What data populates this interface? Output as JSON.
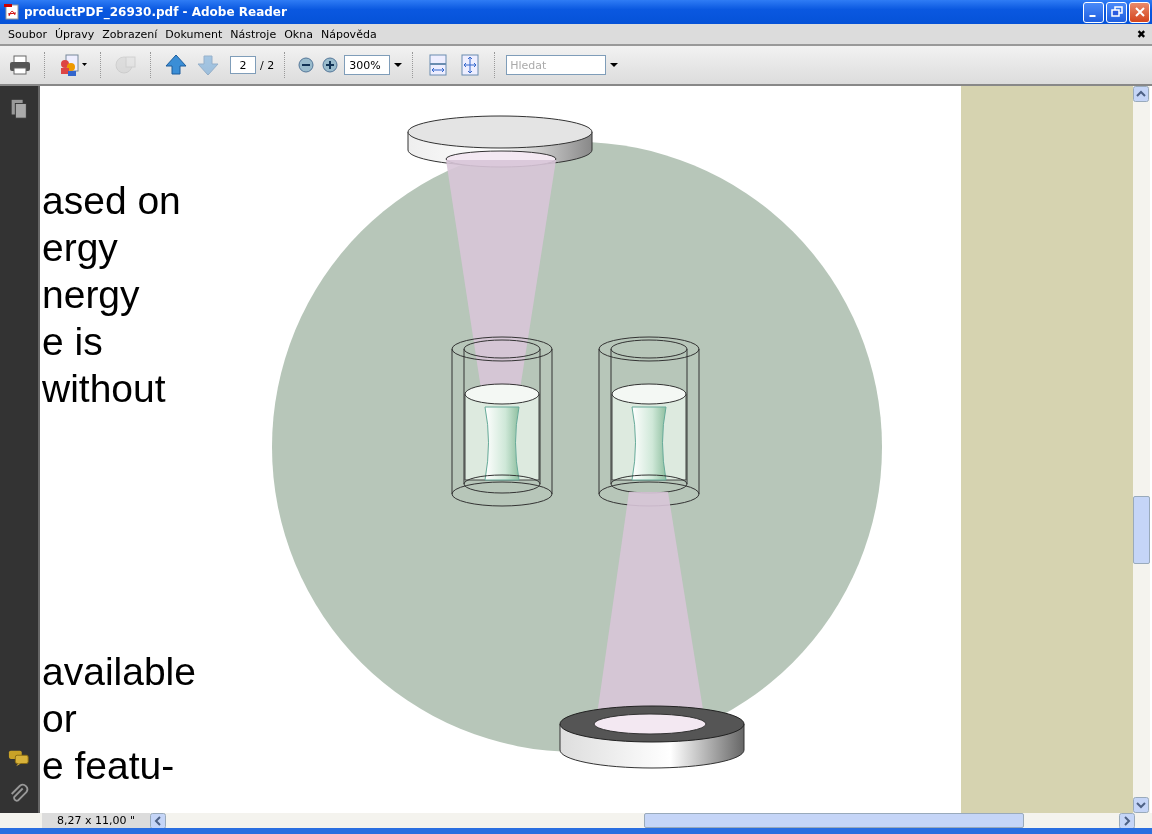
{
  "window": {
    "title": "productPDF_26930.pdf - Adobe Reader"
  },
  "menu": [
    "Soubor",
    "Úpravy",
    "Zobrazení",
    "Dokument",
    "Nástroje",
    "Okna",
    "Nápověda"
  ],
  "menu_close": "✖",
  "toolbar": {
    "buttons": [
      {
        "kind": "print",
        "disabled": false
      },
      {
        "kind": "share",
        "disabled": false
      },
      {
        "kind": "globe",
        "disabled": true
      },
      {
        "kind": "prev",
        "disabled": false
      },
      {
        "kind": "next",
        "disabled": true
      }
    ],
    "page_number": "2",
    "page_total": "/ 2",
    "zoom_out_disabled": false,
    "zoom": "300%",
    "search_placeholder": "Hledat"
  },
  "document": {
    "paragraphs": [
      [
        "ased on",
        "ergy",
        "nergy",
        "e is",
        "without"
      ],
      [
        "available",
        "or",
        "e featu-"
      ]
    ]
  },
  "status": {
    "page_size": "8,27 x 11,00 \""
  }
}
